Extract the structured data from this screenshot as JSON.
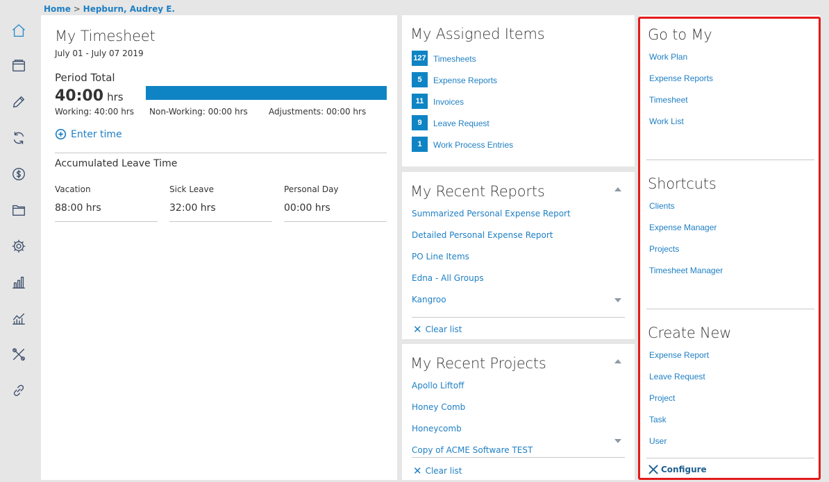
{
  "breadcrumb": {
    "home": "Home",
    "separator": ">",
    "current": "Hepburn, Audrey E."
  },
  "sidebar": [
    {
      "icon": "home-icon"
    },
    {
      "icon": "wallet-icon"
    },
    {
      "icon": "pencil-icon"
    },
    {
      "icon": "sync-icon"
    },
    {
      "icon": "dollar-icon"
    },
    {
      "icon": "folder-icon"
    },
    {
      "icon": "gear-icon"
    },
    {
      "icon": "bar-chart-icon"
    },
    {
      "icon": "line-chart-icon"
    },
    {
      "icon": "tools-icon"
    },
    {
      "icon": "link-icon"
    }
  ],
  "timesheet": {
    "title": "My Timesheet",
    "period": "July 01 - July 07 2019",
    "period_total_label": "Period Total",
    "total_value": "40:00",
    "total_unit": "hrs",
    "progress_fraction": 1.0,
    "working": "Working: 40:00 hrs",
    "non_working": "Non-Working: 00:00 hrs",
    "adjustments": "Adjustments: 00:00 hrs",
    "enter_time": "Enter time",
    "leave_title": "Accumulated Leave Time",
    "leave": [
      {
        "label": "Vacation",
        "value": "88:00 hrs"
      },
      {
        "label": "Sick Leave",
        "value": "32:00 hrs"
      },
      {
        "label": "Personal Day",
        "value": "00:00 hrs"
      }
    ]
  },
  "assigned": {
    "title": "My Assigned Items",
    "items": [
      {
        "count": "127",
        "label": "Timesheets"
      },
      {
        "count": "5",
        "label": "Expense Reports"
      },
      {
        "count": "11",
        "label": "Invoices"
      },
      {
        "count": "9",
        "label": "Leave Request"
      },
      {
        "count": "1",
        "label": "Work Process Entries"
      }
    ]
  },
  "reports": {
    "title": "My Recent Reports",
    "items": [
      "Summarized Personal Expense Report",
      "Detailed Personal Expense Report",
      "PO Line Items",
      "Edna - All Groups",
      "Kangroo"
    ],
    "clear": "Clear list"
  },
  "projects": {
    "title": "My Recent Projects",
    "items": [
      "Apollo Liftoff",
      "Honey Comb",
      "Honeycomb",
      "Copy of ACME Software TEST"
    ],
    "clear": "Clear list"
  },
  "goto": {
    "title": "Go to My",
    "items": [
      "Work Plan",
      "Expense Reports",
      "Timesheet",
      "Work List"
    ]
  },
  "shortcuts": {
    "title": "Shortcuts",
    "items": [
      "Clients",
      "Expense Manager",
      "Projects",
      "Timesheet Manager"
    ]
  },
  "create": {
    "title": "Create New",
    "items": [
      "Expense Report",
      "Leave Request",
      "Project",
      "Task",
      "User"
    ]
  },
  "configure": "Configure",
  "colors": {
    "accent": "#1e7fc4",
    "badge": "#0f84c4",
    "highlight": "#e21b1b"
  }
}
